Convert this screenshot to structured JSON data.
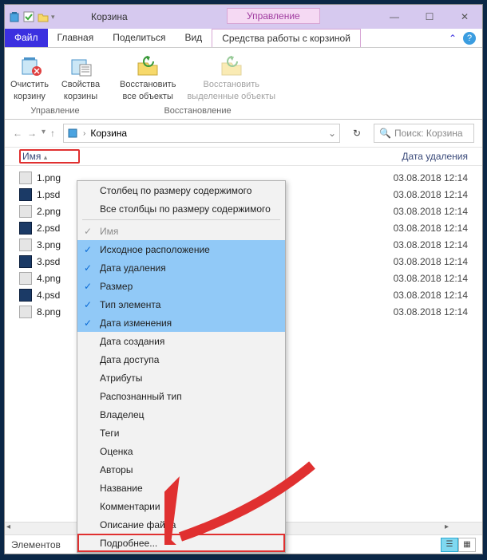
{
  "titlebar": {
    "title": "Корзина",
    "context_tab": "Управление"
  },
  "win": {
    "min": "—",
    "max": "☐",
    "close": "✕"
  },
  "tabs": {
    "file": "Файл",
    "home": "Главная",
    "share": "Поделиться",
    "view": "Вид",
    "ctx": "Средства работы с корзиной"
  },
  "help": {
    "caret": "⌃",
    "q": "?"
  },
  "ribbon": {
    "g1": {
      "label": "Управление",
      "b1l1": "Очистить",
      "b1l2": "корзину",
      "b2l1": "Свойства",
      "b2l2": "корзины"
    },
    "g2": {
      "label": "Восстановление",
      "b1l1": "Восстановить",
      "b1l2": "все объекты",
      "b2l1": "Восстановить",
      "b2l2": "выделенные объекты"
    }
  },
  "nav": {
    "back": "←",
    "fwd": "→",
    "history": "▾",
    "up": "↑",
    "path": "Корзина",
    "chev": "›",
    "dd": "⌄",
    "refresh": "↻"
  },
  "search": {
    "icon": "🔍",
    "placeholder": "Поиск: Корзина"
  },
  "columns": {
    "name": "Имя",
    "sort": "▴",
    "date": "Дата удаления"
  },
  "files": [
    {
      "icon": "png",
      "name": "1.png",
      "date": "03.08.2018 12:14"
    },
    {
      "icon": "psd",
      "name": "1.psd",
      "date": "03.08.2018 12:14"
    },
    {
      "icon": "png",
      "name": "2.png",
      "date": "03.08.2018 12:14"
    },
    {
      "icon": "psd",
      "name": "2.psd",
      "date": "03.08.2018 12:14"
    },
    {
      "icon": "png",
      "name": "3.png",
      "date": "03.08.2018 12:14"
    },
    {
      "icon": "psd",
      "name": "3.psd",
      "date": "03.08.2018 12:14"
    },
    {
      "icon": "png",
      "name": "4.png",
      "date": "03.08.2018 12:14"
    },
    {
      "icon": "psd",
      "name": "4.psd",
      "date": "03.08.2018 12:14"
    },
    {
      "icon": "png",
      "name": "8.png",
      "date": "03.08.2018 12:14"
    }
  ],
  "status": {
    "label": "Элементов"
  },
  "menu": {
    "i0": "Столбец по размеру содержимого",
    "i1": "Все столбцы по размеру содержимого",
    "i2": "Имя",
    "i3": "Исходное расположение",
    "i4": "Дата удаления",
    "i5": "Размер",
    "i6": "Тип элемента",
    "i7": "Дата изменения",
    "i8": "Дата создания",
    "i9": "Дата доступа",
    "i10": "Атрибуты",
    "i11": "Распознанный тип",
    "i12": "Владелец",
    "i13": "Теги",
    "i14": "Оценка",
    "i15": "Авторы",
    "i16": "Название",
    "i17": "Комментарии",
    "i18": "Описание файла",
    "i19": "Подробнее...",
    "check": "✓"
  }
}
